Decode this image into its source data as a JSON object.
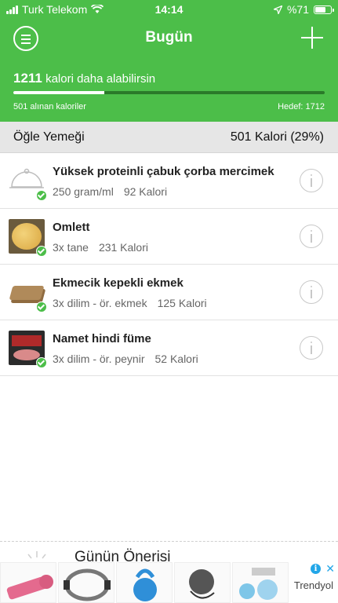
{
  "status_bar": {
    "carrier": "Turk Telekom",
    "time": "14:14",
    "battery": "%71",
    "battery_level": 0.71
  },
  "header": {
    "title": "Bugün"
  },
  "summary": {
    "remaining_value": "1211",
    "remaining_text": "kalori daha alabilirsin",
    "eaten": "501 alınan kaloriler",
    "target": "Hedef: 1712",
    "progress": 0.293
  },
  "meal": {
    "name": "Öğle Yemeği",
    "calories": "501 Kalori (29%)",
    "items": [
      {
        "name": "Yüksek proteinli çabuk çorba mercimek",
        "amount": "250 gram/ml",
        "calories": "92 Kalori",
        "thumb_icon": "cloche-icon"
      },
      {
        "name": "Omlett",
        "amount": "3x tane",
        "calories": "231 Kalori",
        "thumb_icon": "omelet-photo"
      },
      {
        "name": "Ekmecik kepekli ekmek",
        "amount": "3x dilim - ör. ekmek",
        "calories": "125 Kalori",
        "thumb_icon": "bread-photo"
      },
      {
        "name": "Namet hindi füme",
        "amount": "3x dilim - ör. peynir",
        "calories": "52 Kalori",
        "thumb_icon": "turkey-package-photo"
      }
    ]
  },
  "recommendation": {
    "title": "Günün Önerisi"
  },
  "ad": {
    "brand": "Trendyol",
    "info": "i",
    "close": "✕"
  }
}
